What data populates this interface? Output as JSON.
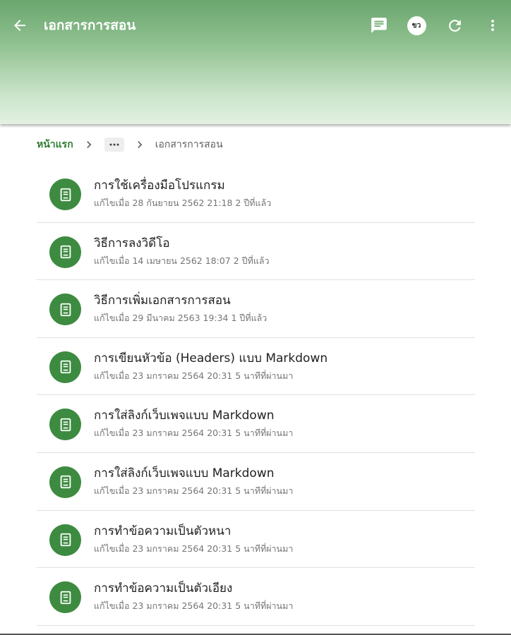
{
  "header": {
    "title": "เอกสารการสอน",
    "avatar_text": "ขว",
    "icons": [
      "arrow-back-icon",
      "comment-icon",
      "refresh-icon",
      "more-vert-icon"
    ]
  },
  "breadcrumb": {
    "home": "หน้าแรก",
    "more": "•••",
    "current": "เอกสารการสอน"
  },
  "documents": [
    {
      "title": "การใช้เครื่องมือโปรแกรม",
      "meta": "แก้ไขเมื่อ 28 กันยายน 2562 21:18 2 ปีที่แล้ว"
    },
    {
      "title": "วิธีการลงวิดีโอ",
      "meta": "แก้ไขเมื่อ 14 เมษายน 2562 18:07 2 ปีที่แล้ว"
    },
    {
      "title": "วิธีการเพิ่มเอกสารการสอน",
      "meta": "แก้ไขเมื่อ 29 มีนาคม 2563 19:34 1 ปีที่แล้ว"
    },
    {
      "title": "การเขียนหัวข้อ (Headers) แบบ Markdown",
      "meta": "แก้ไขเมื่อ 23 มกราคม 2564 20:31 5 นาทีที่ผ่านมา"
    },
    {
      "title": "การใส่ลิงก์เว็บเพจแบบ Markdown",
      "meta": "แก้ไขเมื่อ 23 มกราคม 2564 20:31 5 นาทีที่ผ่านมา"
    },
    {
      "title": "การใส่ลิงก์เว็บเพจแบบ Markdown",
      "meta": "แก้ไขเมื่อ 23 มกราคม 2564 20:31 5 นาทีที่ผ่านมา"
    },
    {
      "title": "การทำข้อความเป็นตัวหนา",
      "meta": "แก้ไขเมื่อ 23 มกราคม 2564 20:31 5 นาทีที่ผ่านมา"
    },
    {
      "title": "การทำข้อความเป็นตัวเอียง",
      "meta": "แก้ไขเมื่อ 23 มกราคม 2564 20:31 5 นาทีที่ผ่านมา"
    }
  ],
  "colors": {
    "accent": "#2e7d32",
    "icon_bg": "#3d8b40",
    "header_top": "#6aa66e"
  }
}
